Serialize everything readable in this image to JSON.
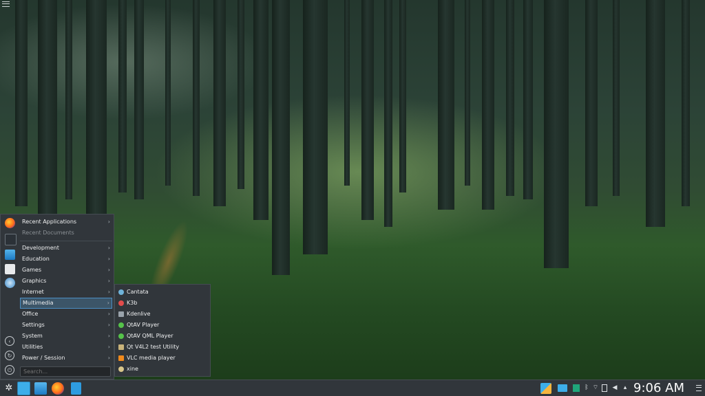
{
  "menu": {
    "items": [
      {
        "label": "Recent Applications",
        "arrow": "›",
        "state": "normal"
      },
      {
        "label": "Recent Documents",
        "arrow": "",
        "state": "disabled"
      },
      {
        "label": "Development",
        "arrow": "›",
        "state": "normal"
      },
      {
        "label": "Education",
        "arrow": "›",
        "state": "normal"
      },
      {
        "label": "Games",
        "arrow": "›",
        "state": "normal"
      },
      {
        "label": "Graphics",
        "arrow": "›",
        "state": "normal"
      },
      {
        "label": "Internet",
        "arrow": "›",
        "state": "normal"
      },
      {
        "label": "Multimedia",
        "arrow": "›",
        "state": "active"
      },
      {
        "label": "Office",
        "arrow": "›",
        "state": "normal"
      },
      {
        "label": "Settings",
        "arrow": "›",
        "state": "normal"
      },
      {
        "label": "System",
        "arrow": "›",
        "state": "normal"
      },
      {
        "label": "Utilities",
        "arrow": "›",
        "state": "normal"
      },
      {
        "label": "Power / Session",
        "arrow": "›",
        "state": "normal"
      }
    ],
    "search_placeholder": "Search...",
    "favorites": [
      "firefox-icon",
      "system-settings-icon",
      "dolphin-icon",
      "kate-icon",
      "thunderbird-icon"
    ],
    "side_buttons": [
      "logout-icon",
      "restart-icon",
      "shutdown-icon"
    ]
  },
  "submenu": {
    "items": [
      {
        "label": "Cantata",
        "icon": "cantata-icon",
        "color": "#6fb3d9"
      },
      {
        "label": "K3b",
        "icon": "k3b-icon",
        "color": "#e24c4c"
      },
      {
        "label": "Kdenlive",
        "icon": "kdenlive-icon",
        "color": "#9aa3ab"
      },
      {
        "label": "QtAV Player",
        "icon": "qtav-icon",
        "color": "#55c24a"
      },
      {
        "label": "QtAV QML Player",
        "icon": "qtav-qml-icon",
        "color": "#55c24a"
      },
      {
        "label": "Qt V4L2 test Utility",
        "icon": "v4l2-icon",
        "color": "#c9b37a"
      },
      {
        "label": "VLC media player",
        "icon": "vlc-icon",
        "color": "#f08a1c"
      },
      {
        "label": "xine",
        "icon": "xine-icon",
        "color": "#d8c68a"
      }
    ]
  },
  "taskbar": {
    "launcher": "kde-launcher-icon",
    "apps": [
      "desktop-pager-icon",
      "dolphin-icon",
      "firefox-icon",
      "kate-icon"
    ],
    "tray": [
      "update-icon",
      "folder-icon",
      "clipboard-icon",
      "bluetooth-icon",
      "network-icon",
      "battery-icon",
      "volume-icon",
      "tray-expand-icon"
    ],
    "clock": "9:06 AM"
  },
  "colors": {
    "panel": "#31363b",
    "highlight": "#3daee9"
  }
}
